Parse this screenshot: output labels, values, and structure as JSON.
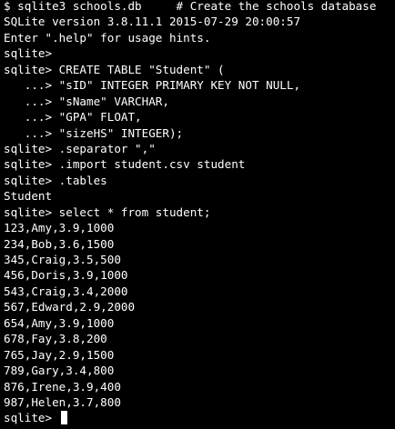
{
  "terminal": {
    "lines": [
      "$ sqlite3 schools.db     # Create the schools database",
      "SQLite version 3.8.11.1 2015-07-29 20:00:57",
      "Enter \".help\" for usage hints.",
      "sqlite>",
      "sqlite> CREATE TABLE \"Student\" (",
      "   ...> \"sID\" INTEGER PRIMARY KEY NOT NULL,",
      "   ...> \"sName\" VARCHAR,",
      "   ...> \"GPA\" FLOAT,",
      "   ...> \"sizeHS\" INTEGER);",
      "sqlite> .separator \",\"",
      "sqlite> .import student.csv student",
      "sqlite> .tables",
      "Student",
      "sqlite> select * from student;",
      "123,Amy,3.9,1000",
      "234,Bob,3.6,1500",
      "345,Craig,3.5,500",
      "456,Doris,3.9,1000",
      "543,Craig,3.4,2000",
      "567,Edward,2.9,2000",
      "654,Amy,3.9,1000",
      "678,Fay,3.8,200",
      "765,Jay,2.9,1500",
      "789,Gary,3.4,800",
      "876,Irene,3.9,400",
      "987,Helen,3.7,800"
    ],
    "prompt": "sqlite> "
  },
  "colors": {
    "background": "#000000",
    "text": "#ffffff"
  }
}
